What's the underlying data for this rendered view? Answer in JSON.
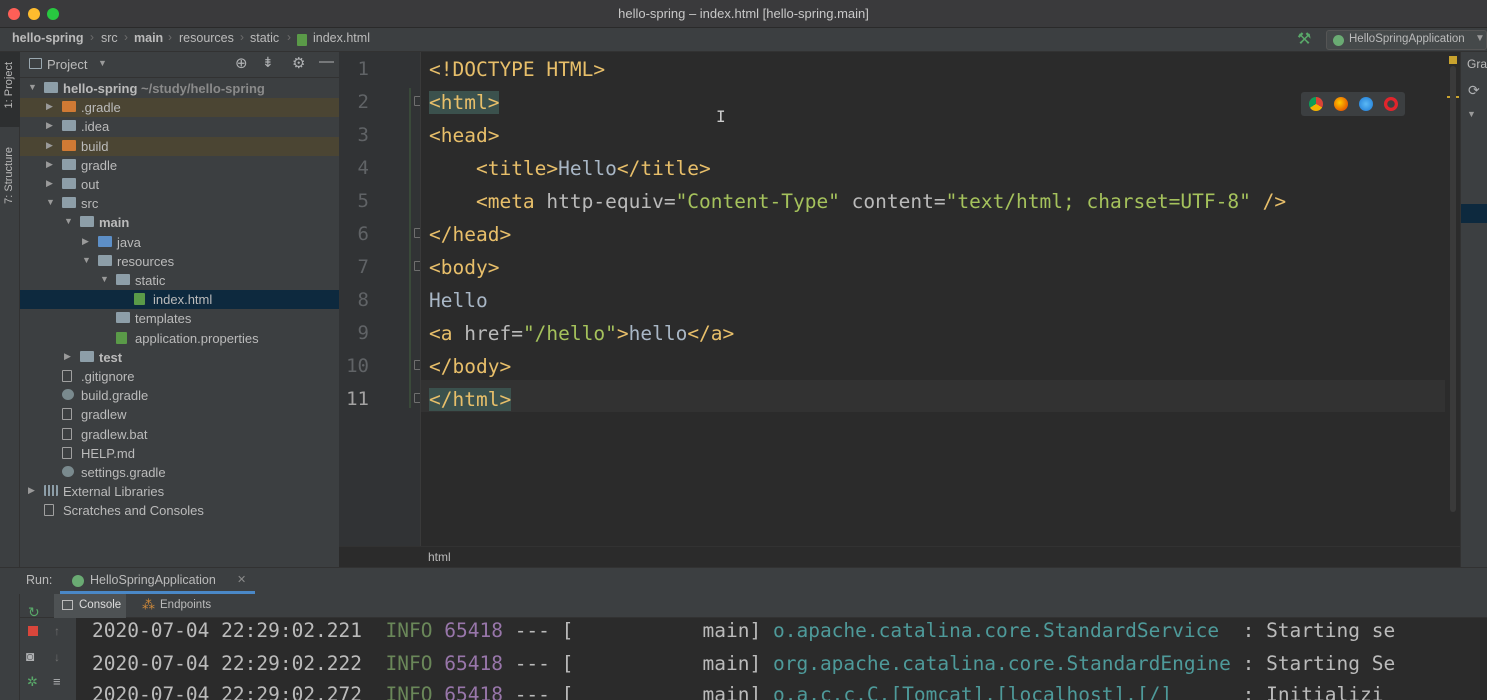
{
  "window": {
    "title": "hello-spring – index.html [hello-spring.main]"
  },
  "breadcrumbs": [
    "hello-spring",
    "src",
    "main",
    "resources",
    "static",
    "index.html"
  ],
  "run_config": "HelloSpringApplication",
  "left_stripe": {
    "project_tab": "1: Project",
    "structure_tab": "7: Structure"
  },
  "project_panel": {
    "title": "Project",
    "tree": [
      {
        "label": "hello-spring",
        "hint": "~/study/hello-spring",
        "depth": 0,
        "arrow": "down",
        "icon": "module-folder-icon",
        "bold": true
      },
      {
        "label": ".gradle",
        "depth": 1,
        "arrow": "right",
        "icon": "folder-orange-icon"
      },
      {
        "label": ".idea",
        "depth": 1,
        "arrow": "right",
        "icon": "folder-gray-icon"
      },
      {
        "label": "build",
        "depth": 1,
        "arrow": "right",
        "icon": "folder-orange-icon"
      },
      {
        "label": "gradle",
        "depth": 1,
        "arrow": "right",
        "icon": "folder-gray-icon"
      },
      {
        "label": "out",
        "depth": 1,
        "arrow": "right",
        "icon": "folder-gray-icon"
      },
      {
        "label": "src",
        "depth": 1,
        "arrow": "down",
        "icon": "folder-gray-icon"
      },
      {
        "label": "main",
        "depth": 2,
        "arrow": "down",
        "icon": "folder-gray-icon",
        "bold": true
      },
      {
        "label": "java",
        "depth": 3,
        "arrow": "right",
        "icon": "folder-blue-icon"
      },
      {
        "label": "resources",
        "depth": 3,
        "arrow": "down",
        "icon": "folder-gray-icon"
      },
      {
        "label": "static",
        "depth": 4,
        "arrow": "down",
        "icon": "folder-gray-icon"
      },
      {
        "label": "index.html",
        "depth": 5,
        "arrow": "",
        "icon": "html-file-icon",
        "selected": true
      },
      {
        "label": "templates",
        "depth": 4,
        "arrow": "",
        "icon": "folder-gray-icon"
      },
      {
        "label": "application.properties",
        "depth": 4,
        "arrow": "",
        "icon": "properties-file-icon"
      },
      {
        "label": "test",
        "depth": 2,
        "arrow": "right",
        "icon": "folder-gray-icon",
        "bold": true
      },
      {
        "label": ".gitignore",
        "depth": 1,
        "arrow": "",
        "icon": "file-icon"
      },
      {
        "label": "build.gradle",
        "depth": 1,
        "arrow": "",
        "icon": "gradle-file-icon"
      },
      {
        "label": "gradlew",
        "depth": 1,
        "arrow": "",
        "icon": "file-icon"
      },
      {
        "label": "gradlew.bat",
        "depth": 1,
        "arrow": "",
        "icon": "file-icon"
      },
      {
        "label": "HELP.md",
        "depth": 1,
        "arrow": "",
        "icon": "markdown-file-icon"
      },
      {
        "label": "settings.gradle",
        "depth": 1,
        "arrow": "",
        "icon": "gradle-file-icon"
      },
      {
        "label": "External Libraries",
        "depth": 0,
        "arrow": "right",
        "icon": "library-icon"
      },
      {
        "label": "Scratches and Consoles",
        "depth": 0,
        "arrow": "",
        "icon": "scratches-icon"
      }
    ]
  },
  "editor": {
    "line_numbers": [
      "1",
      "2",
      "3",
      "4",
      "5",
      "6",
      "7",
      "8",
      "9",
      "10",
      "11"
    ],
    "lines": {
      "l1": "<!DOCTYPE HTML>",
      "l2": "<html>",
      "l3": "<head>",
      "l4_indent": "    ",
      "l4_open": "<title>",
      "l4_text": "Hello",
      "l4_close": "</title>",
      "l5_indent": "    ",
      "l5_a": "<meta ",
      "l5_b": "http-equiv=",
      "l5_c": "\"Content-Type\"",
      "l5_d": " content=",
      "l5_e": "\"text/html; charset=UTF-8\"",
      "l5_f": " />",
      "l6": "</head>",
      "l7": "<body>",
      "l8": "Hello",
      "l9_a": "<a ",
      "l9_b": "href=",
      "l9_c": "\"/hello\"",
      "l9_d": ">",
      "l9_e": "hello",
      "l9_f": "</a>",
      "l10": "</body>",
      "l11": "</html>"
    },
    "breadcrumb": "html"
  },
  "right_panel": {
    "label": "Gra"
  },
  "run": {
    "label": "Run:",
    "tab": "HelloSpringApplication",
    "tabs": [
      "Console",
      "Endpoints"
    ],
    "logs": [
      {
        "ts": "2020-07-04 22:29:02.221",
        "level": "INFO",
        "pid": "65418",
        "sep": "--- [",
        "thread": "           main]",
        "logger": "o.apache.catalina.core.StandardService",
        "msg": "  : Starting se"
      },
      {
        "ts": "2020-07-04 22:29:02.222",
        "level": "INFO",
        "pid": "65418",
        "sep": "--- [",
        "thread": "           main]",
        "logger": "org.apache.catalina.core.StandardEngine",
        "msg": " : Starting Se"
      },
      {
        "ts": "2020-07-04 22:29:02.272",
        "level": "INFO",
        "pid": "65418",
        "sep": "--- [",
        "thread": "           main]",
        "logger": "o.a.c.c.C.[Tomcat].[localhost].[/]",
        "msg": "      : Initializi"
      }
    ]
  },
  "colors": {
    "bg": "#2b2b2b",
    "panel": "#3c3f41",
    "tag": "#e8bf6a",
    "string": "#a5c25c",
    "selection": "#0d293e"
  }
}
